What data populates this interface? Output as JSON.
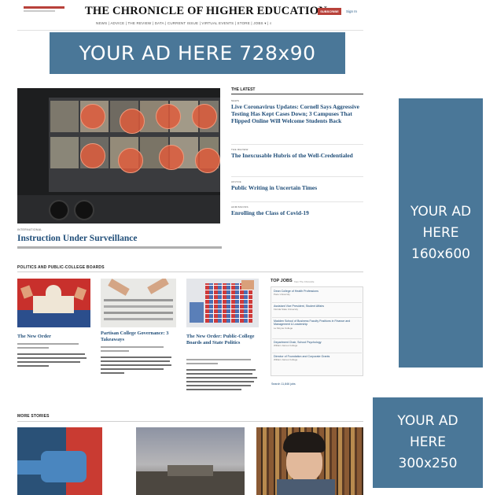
{
  "header": {
    "masthead": "THE CHRONICLE OF HIGHER EDUCATION",
    "subscribe_label": "SUBSCRIBE",
    "signin_label": "Sign In",
    "nav": "NEWS | ADVICE | THE REVIEW | DATA | CURRENT ISSUE | VIRTUAL EVENTS | STORE | JOBS ▾ | ⌕"
  },
  "ads": {
    "leaderboard": "YOUR AD HERE 728x90",
    "skyscraper": [
      "YOUR AD",
      "HERE",
      "160x600"
    ],
    "rectangle": [
      "YOUR AD",
      "HERE",
      "300x250"
    ]
  },
  "hero": {
    "kicker": "INTERNATIONAL",
    "title": "Instruction Under Surveillance"
  },
  "latest": {
    "heading": "THE LATEST",
    "items": [
      {
        "kicker": "NEWS",
        "title": "Live Coronavirus Updates: Cornell Says Aggressive Testing Has Kept Cases Down; 3 Campuses That Flipped Online Will Welcome Students Back"
      },
      {
        "kicker": "THE REVIEW",
        "title": "The Inexcusable Hubris of the Well-Credentialed"
      },
      {
        "kicker": "ADVICE",
        "title": "Public Writing in Uncertain Times"
      },
      {
        "kicker": "ADMISSIONS",
        "title": "Enrolling the Class of Covid-19"
      }
    ]
  },
  "politics": {
    "heading": "POLITICS AND PUBLIC-COLLEGE BOARDS",
    "cards": [
      {
        "title": "The New Order"
      },
      {
        "title": "Partisan College Governance: 3 Takeaways"
      },
      {
        "title": "The New Order: Public-College Boards and State Politics"
      }
    ]
  },
  "jobs": {
    "heading": "TOP JOBS",
    "from": "from The Chronicle",
    "listings": [
      {
        "title": "Dean College of Health Professions",
        "org": "Pace University"
      },
      {
        "title": "Assistant Vice President, Student Affairs",
        "org": "Florida State University"
      },
      {
        "title": "Madden School of Business Faculty Positions in Finance and Management & Leadership",
        "org": "Le Moyne College"
      },
      {
        "title": "Department Chair, School Psychology",
        "org": "William James College"
      },
      {
        "title": "Director of Foundation and Corporate Grants",
        "org": "William James College"
      }
    ],
    "search_link": "Search 11,846 jobs"
  },
  "more_stories": {
    "heading": "MORE STORIES"
  },
  "colors": {
    "ad_blue": "#4a7798",
    "headline_blue": "#1f4d78",
    "brand_red": "#b8413a"
  }
}
